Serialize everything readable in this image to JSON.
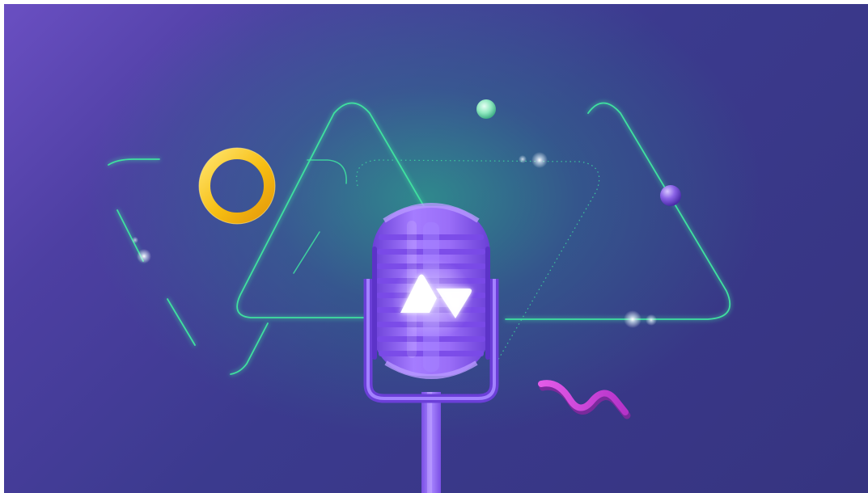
{
  "scene": {
    "background_colors": [
      "#6a4fc2",
      "#3b3a8e",
      "#2f8f8a"
    ],
    "accent_green": "#3fe0a0",
    "ring_color": "#f7c21a",
    "microphone_color": "#8b5cf0",
    "squiggle_color": "#d445d8",
    "logo_icon": "logo-icon",
    "microphone_icon": "microphone-icon",
    "ring_icon": "ring-shape",
    "sparkle_icon": "sparkle-icon"
  }
}
